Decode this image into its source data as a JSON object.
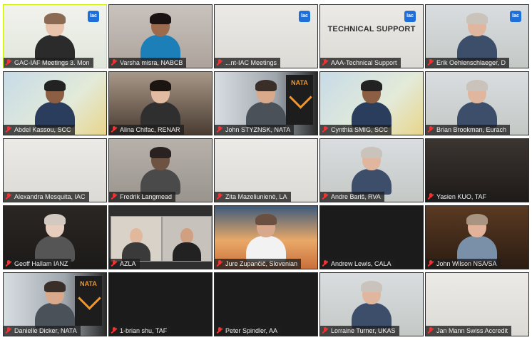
{
  "participants": [
    {
      "name": "GAC-IAF Meetings 3. Mon",
      "active": true,
      "scene": "bright",
      "badge": "lac"
    },
    {
      "name": "Varsha misra, NABCB",
      "scene": "office"
    },
    {
      "name": "...nt-IAC Meetings",
      "scene": "plain",
      "badge": "lac"
    },
    {
      "name": "AAA-Technical Support",
      "scene": "plain",
      "badge": "lac",
      "sign": "TECHNICAL SUPPORT"
    },
    {
      "name": "Erik Oehlenschlaeger, D",
      "scene": "room",
      "badge": "lac"
    },
    {
      "name": "Abdel Kassou, SCC",
      "scene": "city"
    },
    {
      "name": "Alina Chifac, RENAR",
      "scene": "home"
    },
    {
      "name": "John STYZNSK, NATA",
      "scene": "nata",
      "nata": "NATA"
    },
    {
      "name": "Cynthia SMIG, SCC",
      "scene": "city"
    },
    {
      "name": "Brian Brookman, Eurach",
      "scene": "room"
    },
    {
      "name": "Alexandra Mesquita, IAC",
      "scene": "plain"
    },
    {
      "name": "Fredrik Langmead",
      "scene": "dim"
    },
    {
      "name": "Zita Mazeliunienė, LA",
      "scene": "plain"
    },
    {
      "name": "Andre Bariš, RVA",
      "scene": "room"
    },
    {
      "name": "Yasien KUO, TAF",
      "scene": "dark"
    },
    {
      "name": "Geoff Hallam IANZ",
      "scene": "gallery"
    },
    {
      "name": "AZLA",
      "scene": "split"
    },
    {
      "name": "Jure Zupančič, Slovenian",
      "scene": "bridge"
    },
    {
      "name": "Andrew Lewis, CALA",
      "scene": "black"
    },
    {
      "name": "John Wilson NSA/SA",
      "scene": "cabin"
    },
    {
      "name": "Danielle Dicker, NATA",
      "scene": "nata",
      "nata": "NATA"
    },
    {
      "name": "1-brian shu, TAF",
      "scene": "black"
    },
    {
      "name": "Peter Spindler, AA",
      "scene": "black"
    },
    {
      "name": "Lorraine Turner, UKAS",
      "scene": "room"
    },
    {
      "name": "Jan Mann Swiss Accredit",
      "scene": "plain"
    }
  ],
  "colors": {
    "active_border": "#c8f000",
    "mic_muted": "#e33333",
    "label_bg": "#1e1e1e",
    "nata_orange": "#f0962a",
    "badge_blue": "#1e6fd9"
  }
}
